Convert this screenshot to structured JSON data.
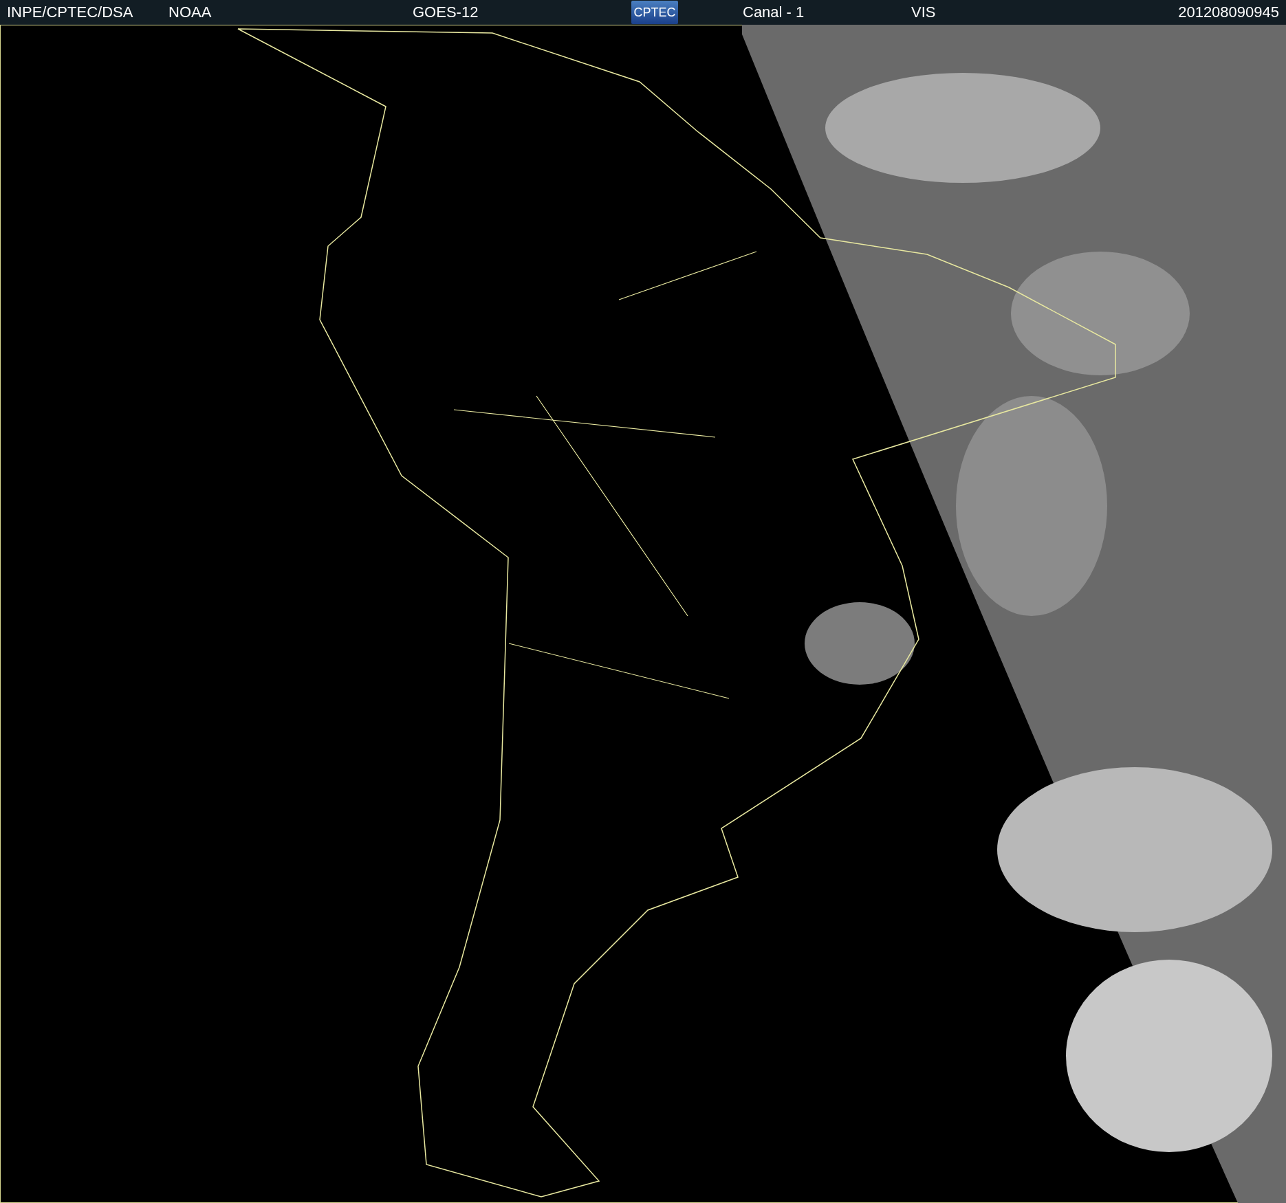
{
  "header": {
    "source": "INPE/CPTEC/DSA",
    "agency": "NOAA",
    "satellite": "GOES-12",
    "logo": "CPTEC",
    "channel": "Canal - 1",
    "band": "VIS",
    "timestamp": "201208090945"
  }
}
